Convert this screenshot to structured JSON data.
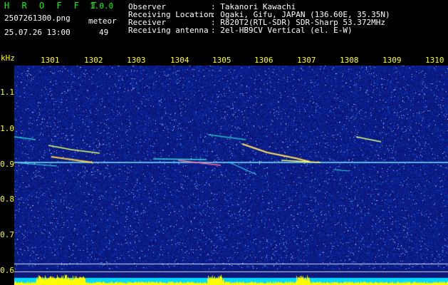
{
  "app": {
    "name": "H R O F F T",
    "version": "1.0.0"
  },
  "file": {
    "filename": "2507261300.png",
    "timestamp": "25.07.26 13:00"
  },
  "meteor": {
    "label": "meteor",
    "count": "49"
  },
  "info": {
    "labels": [
      "Observer",
      "Receiving Location",
      "Receiver",
      "Receiving antenna"
    ],
    "values": [
      ": Takanori Kawachi",
      ": Ogaki, Gifu, JAPAN (136.60E, 35.35N)",
      ": R820T2(RTL-SDR) SDR-Sharp 53.372MHz",
      ": 2el-HB9CV Vertical (el. E-W)"
    ]
  },
  "axis": {
    "y_unit": "kHz",
    "y_ticks": [
      "1.1",
      "1.0",
      "0.9",
      "0.8",
      "0.7",
      "0.6"
    ],
    "x_ticks": [
      "1301",
      "1302",
      "1303",
      "1304",
      "1305",
      "1306",
      "1307",
      "1308",
      "1309",
      "1310"
    ]
  },
  "colors": {
    "background": "#000000",
    "label_green": "#00ff00",
    "label_yellow": "#ffff00",
    "text_white": "#ffffff",
    "noise_floor": "#0c1a7a",
    "level_bar": "#00d8ff"
  }
}
